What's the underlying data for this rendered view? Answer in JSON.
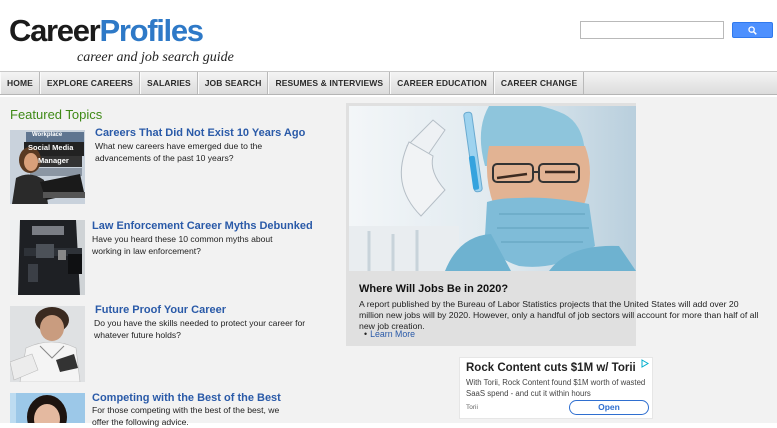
{
  "header": {
    "logo_part1": "Career",
    "logo_part2": "Profiles",
    "tagline": "career and job search guide"
  },
  "search": {
    "value": "",
    "button_icon": "search-icon"
  },
  "nav": {
    "items": [
      "HOME",
      "EXPLORE CAREERS",
      "SALARIES",
      "JOB SEARCH",
      "RESUMES & INTERVIEWS",
      "CAREER EDUCATION",
      "CAREER CHANGE"
    ]
  },
  "featured": {
    "heading": "Featured Topics",
    "topics": [
      {
        "title": "Careers That Did Not Exist 10 Years Ago",
        "desc": "What new careers have emerged due to the advancements of the past 10 years?",
        "thumb_text_1": "Workplace",
        "thumb_text_2": "Social Media",
        "thumb_text_3": "Manager"
      },
      {
        "title": "Law Enforcement Career Myths Debunked",
        "desc": "Have you heard these 10 common myths about working in law enforcement?"
      },
      {
        "title": "Future Proof Your Career",
        "desc": "Do you have the skills needed to protect your career for whatever future holds?"
      },
      {
        "title": "Competing with the Best of the Best",
        "desc": "For those competing with the best of the best, we offer the following advice."
      }
    ]
  },
  "feature": {
    "title": "Where Will Jobs Be in 2020?",
    "text": "A report published by the Bureau of Labor Statistics projects that the United States will add over 20 million new jobs will by 2020. However, only a handful of job sectors will account for more than half of all new job creation.",
    "link": "Learn More",
    "bullet": "•"
  },
  "ad": {
    "title": "Rock Content cuts $1M w/ Torii",
    "text": "With Torii, Rock Content found $1M worth of wasted SaaS spend - and cut it within hours",
    "brand": "Torii",
    "button": "Open"
  },
  "colors": {
    "brand_blue": "#2e79c7",
    "link_blue": "#2a5aa8",
    "heading_green": "#3f8a16",
    "search_button": "#4d90fe"
  }
}
